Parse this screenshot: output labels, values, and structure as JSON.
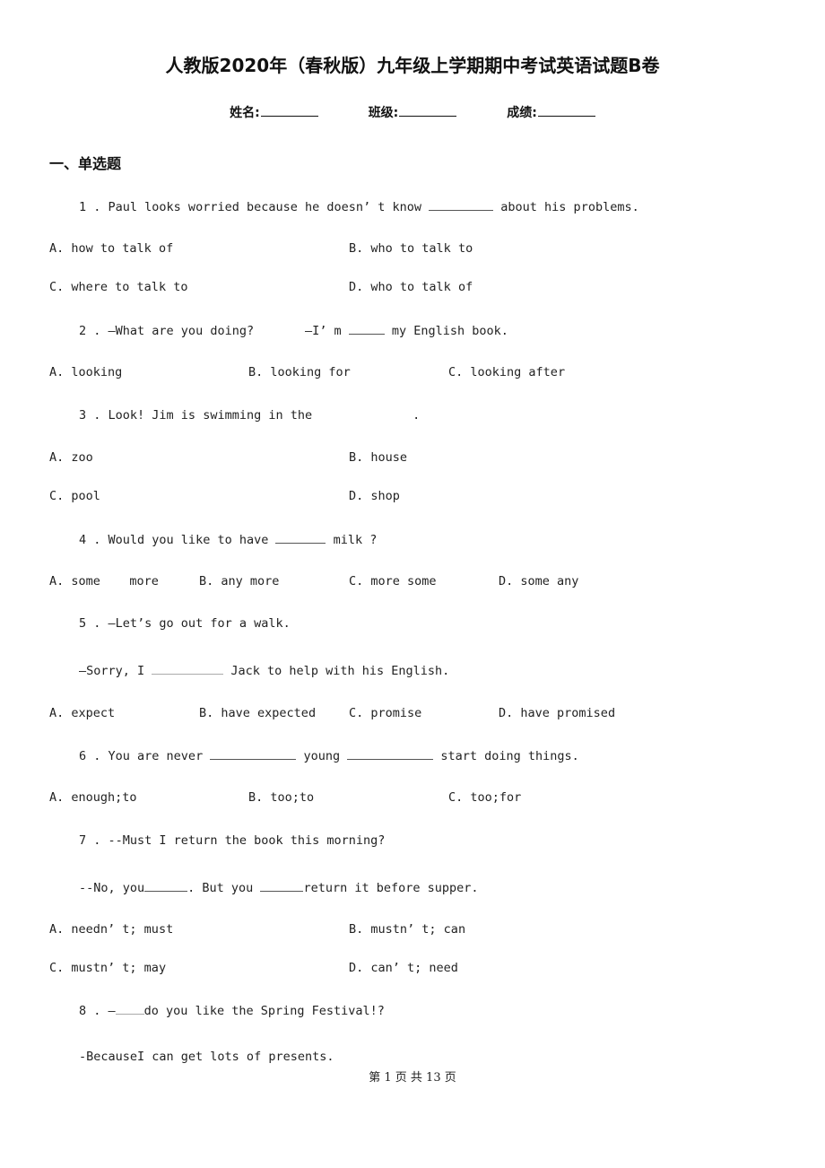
{
  "document": {
    "title": "人教版2020年（春秋版）九年级上学期期中考试英语试题B卷",
    "info_fields": [
      {
        "label": "姓名:"
      },
      {
        "label": "班级:"
      },
      {
        "label": "成绩:"
      }
    ],
    "section": {
      "heading": "一、单选题"
    },
    "questions": [
      {
        "number": "1 .",
        "lines": [
          {
            "before": "Paul looks worried because he doesn’ t know ",
            "after": " about his problems."
          }
        ],
        "options": [
          {
            "letter": "A.",
            "text": "how to talk of"
          },
          {
            "letter": "B.",
            "text": "who to talk to"
          },
          {
            "letter": "C.",
            "text": "where to talk to"
          },
          {
            "letter": "D.",
            "text": "who to talk of"
          }
        ]
      },
      {
        "number": "2 .",
        "lines": [
          {
            "before": "—What are you doing?       —I’ m ",
            "after": " my English book."
          }
        ],
        "options": [
          {
            "letter": "A.",
            "text": "looking"
          },
          {
            "letter": "B.",
            "text": "looking for"
          },
          {
            "letter": "C.",
            "text": "looking after"
          }
        ]
      },
      {
        "number": "3 .",
        "lines": [
          {
            "before": "Look! Jim is swimming in the",
            "after": "."
          }
        ],
        "options": [
          {
            "letter": "A.",
            "text": "zoo"
          },
          {
            "letter": "B.",
            "text": "house"
          },
          {
            "letter": "C.",
            "text": "pool"
          },
          {
            "letter": "D.",
            "text": "shop"
          }
        ]
      },
      {
        "number": "4 .",
        "lines": [
          {
            "before": "Would you like to have ",
            "after": " milk ?"
          }
        ],
        "options": [
          {
            "letter": "A.",
            "text": "some    more"
          },
          {
            "letter": "B.",
            "text": "any more"
          },
          {
            "letter": "C.",
            "text": "more some"
          },
          {
            "letter": "D.",
            "text": "some any"
          }
        ]
      },
      {
        "number": "5 .",
        "lines": [
          {
            "text": "—Let’s go out for a walk."
          },
          {
            "before": "—Sorry, I ",
            "after": " Jack to help with his English."
          }
        ],
        "options": [
          {
            "letter": "A.",
            "text": "expect"
          },
          {
            "letter": "B.",
            "text": "have expected"
          },
          {
            "letter": "C.",
            "text": "promise"
          },
          {
            "letter": "D.",
            "text": "have promised"
          }
        ]
      },
      {
        "number": "6 .",
        "lines": [
          {
            "before": "You are never ",
            "middle": " young ",
            "after": " start doing things."
          }
        ],
        "options": [
          {
            "letter": "A.",
            "text": "enough;to"
          },
          {
            "letter": "B.",
            "text": "too;to"
          },
          {
            "letter": "C.",
            "text": "too;for"
          }
        ]
      },
      {
        "number": "7 .",
        "lines": [
          {
            "text": "--Must I return the book this morning?"
          },
          {
            "before": "--No, you",
            "middle": ". But you ",
            "after": "return it before supper."
          }
        ],
        "options": [
          {
            "letter": "A.",
            "text": "needn’ t; must"
          },
          {
            "letter": "B.",
            "text": "mustn’ t; can"
          },
          {
            "letter": "C.",
            "text": "mustn’ t; may"
          },
          {
            "letter": "D.",
            "text": "can’ t; need"
          }
        ]
      },
      {
        "number": "8 .",
        "lines": [
          {
            "before": "—",
            "after": "do you like the Spring Festival!?"
          },
          {
            "text": "-BecauseI can get lots of presents."
          }
        ]
      }
    ],
    "footer": {
      "page_label": "第 1 页 共 13 页"
    }
  }
}
